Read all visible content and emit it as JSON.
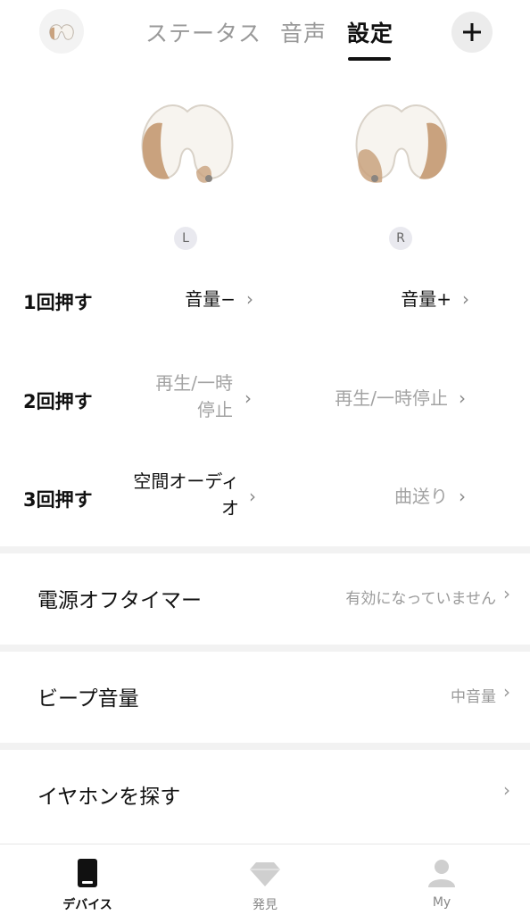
{
  "header": {
    "tabs": [
      {
        "label": "ステータス"
      },
      {
        "label": "音声"
      },
      {
        "label": "設定"
      }
    ],
    "active_tab": "設定",
    "add_label": "+"
  },
  "earbuds": {
    "left_badge": "L",
    "right_badge": "R"
  },
  "press_settings": [
    {
      "label": "1回押す",
      "left": "音量−",
      "right": "音量+"
    },
    {
      "label": "2回押す",
      "left_line1": "再生/一時",
      "left_line2": "停止",
      "right": "再生/一時停止"
    },
    {
      "label": "3回押す",
      "left_line1": "空間オーディ",
      "left_line2": "オ",
      "right": "曲送り"
    }
  ],
  "settings": [
    {
      "label": "電源オフタイマー",
      "value": "有効になっていません"
    },
    {
      "label": "ビープ音量",
      "value": "中音量"
    },
    {
      "label": "イヤホンを探す",
      "value": ""
    }
  ],
  "chevron": "›",
  "bottom_nav": [
    {
      "label": "デバイス",
      "icon": "device-icon"
    },
    {
      "label": "発見",
      "icon": "diamond-icon"
    },
    {
      "label": "My",
      "icon": "person-icon"
    }
  ],
  "colors": {
    "active_text": "#111111",
    "inactive_text": "#999999",
    "separator": "#f2f2f2",
    "earbud_gold": "#c9a27e"
  }
}
